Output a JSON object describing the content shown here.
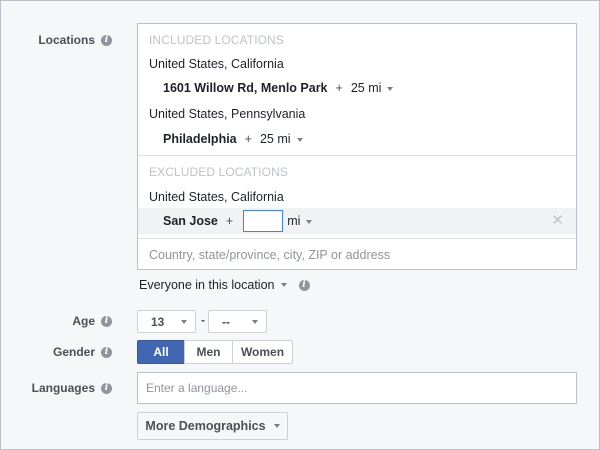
{
  "locations": {
    "label": "Locations",
    "included_heading": "INCLUDED LOCATIONS",
    "included": [
      {
        "region": "United States, California",
        "place": "1601 Willow Rd, Menlo Park",
        "plus": "+",
        "radius": "25 mi"
      },
      {
        "region": "United States, Pennsylvania",
        "place": "Philadelphia",
        "plus": "+",
        "radius": "25 mi"
      }
    ],
    "excluded_heading": "EXCLUDED LOCATIONS",
    "excluded": [
      {
        "region": "United States, California",
        "place": "San Jose",
        "plus": "+",
        "radius_value": "",
        "unit": "mi",
        "remove": "✕"
      }
    ],
    "search_placeholder": "Country, state/province, city, ZIP or address",
    "audience_filter": "Everyone in this location"
  },
  "age": {
    "label": "Age",
    "min": "13",
    "separator": "-",
    "max": "--"
  },
  "gender": {
    "label": "Gender",
    "options": [
      "All",
      "Men",
      "Women"
    ],
    "selected": "All"
  },
  "languages": {
    "label": "Languages",
    "placeholder": "Enter a language..."
  },
  "more_demographics": {
    "label": "More Demographics"
  },
  "icons": {
    "info": "info-icon",
    "dropdown": "caret-down-icon",
    "remove": "close-icon"
  },
  "colors": {
    "primary": "#4267b2",
    "focus": "#4080ff",
    "muted": "#bec2c9"
  }
}
